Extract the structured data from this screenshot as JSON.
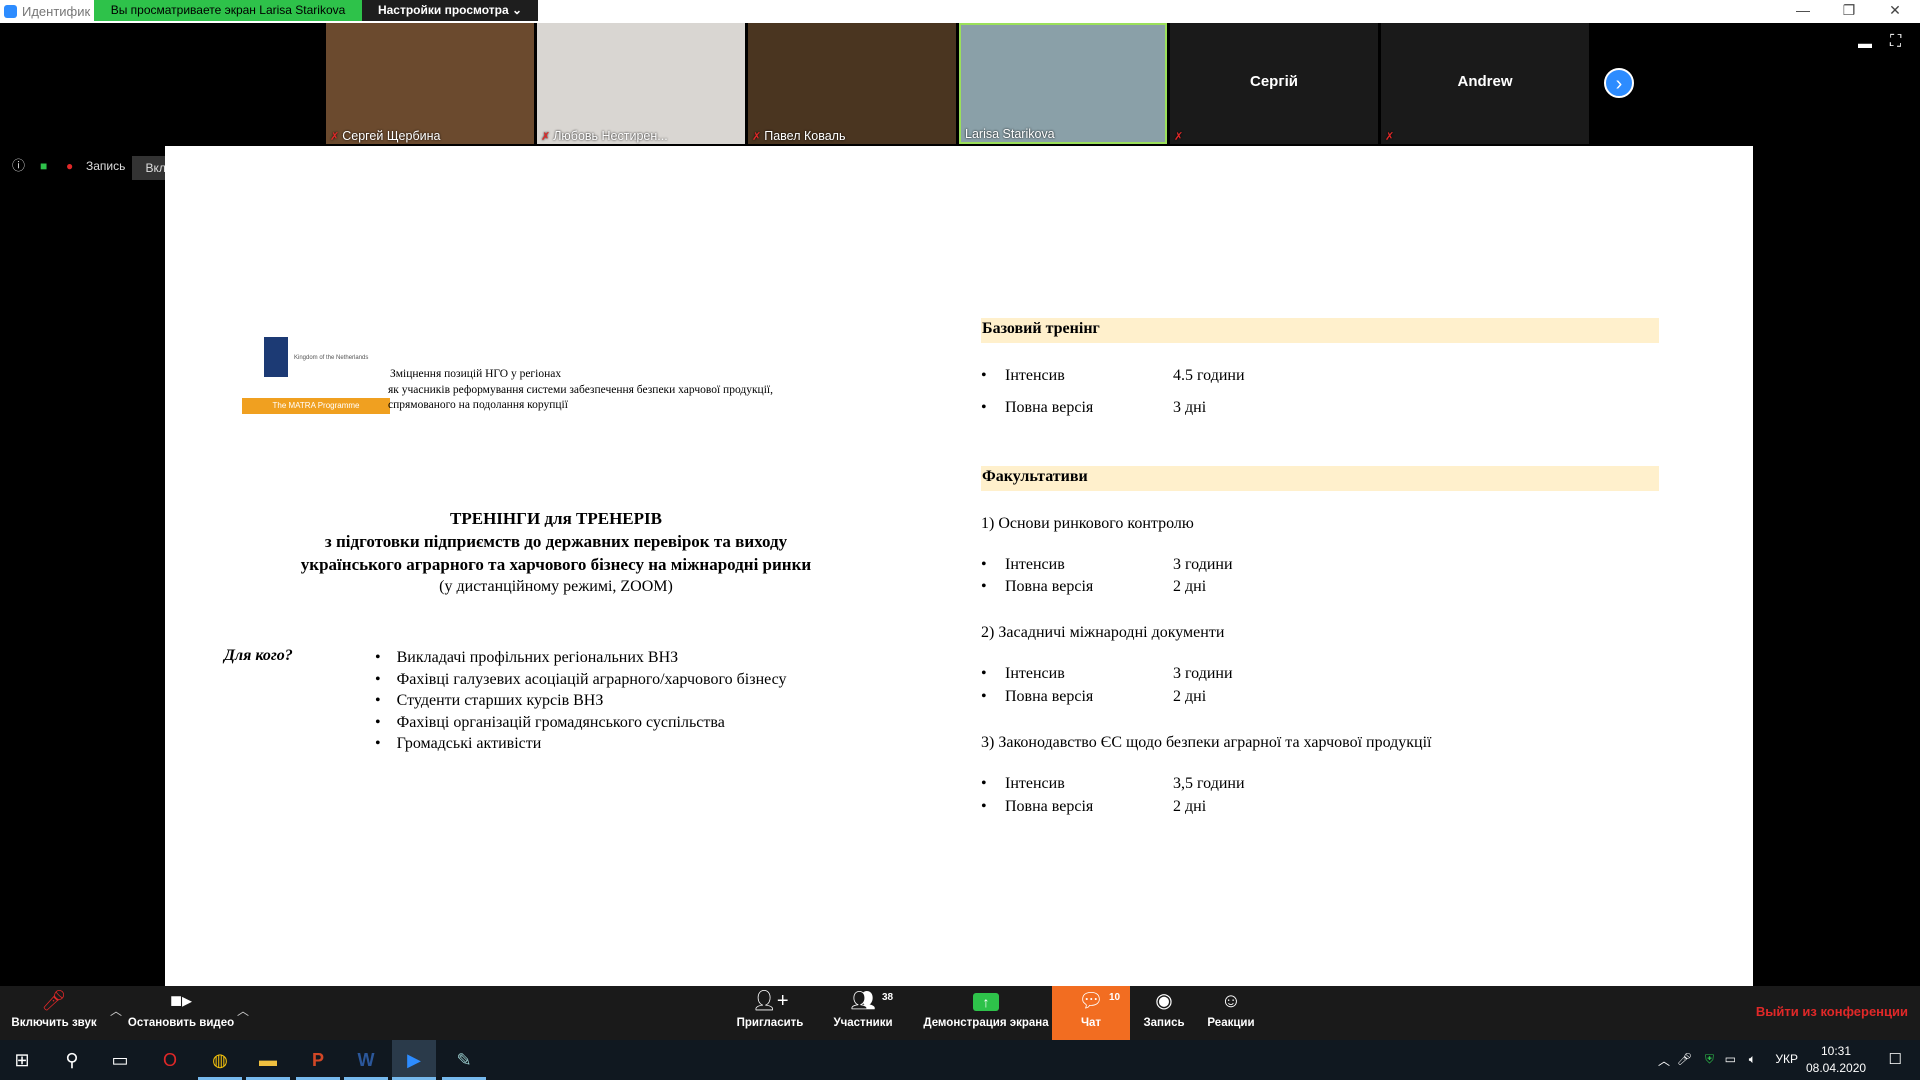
{
  "titlebar": {
    "app_title": "Идентифик",
    "share_banner": "Вы просматриваете экран Larisa Starikova",
    "view_options": "Настройки просмотра ⌄",
    "minimize": "—",
    "restore": "❐",
    "close": "✕"
  },
  "participants": [
    {
      "name": "Сергей Щербина",
      "muted": true,
      "video": true,
      "bg": "#6b4a2e"
    },
    {
      "name": "Любовь Нестирен...",
      "muted": true,
      "video": true,
      "bg": "#d9d6d2"
    },
    {
      "name": "Павел Коваль",
      "muted": true,
      "video": true,
      "bg": "#4a3520"
    },
    {
      "name": "Larisa Starikova",
      "muted": false,
      "video": true,
      "active": true,
      "bg": "#8aa0a8"
    },
    {
      "name": "Сергій",
      "muted": true,
      "video": false
    },
    {
      "name": "Andrew",
      "muted": true,
      "video": false
    }
  ],
  "infobar": {
    "record_label": "Запись",
    "original_sound": "Включить оригинальный звук"
  },
  "slide": {
    "ngo_line1": "Зміцнення позицій НГО у регіонах",
    "ngo_line2": "як учасників реформування системи забезпечення безпеки харчової продукції,",
    "ngo_line3": "спрямованого на подолання корупції",
    "logo_country": "Kingdom of the Netherlands",
    "logo_programme": "The MATRA Programme",
    "title1": "ТРЕНІНГИ для ТРЕНЕРІВ",
    "title2": "з підготовки підприємств до державних перевірок та виходу",
    "title3": "українського аграрного та харчового бізнесу на міжнародні ринки",
    "title4": "(у дистанційному режимі, ZOOM)",
    "for_whom": "Для кого?",
    "audience": [
      "Викладачі профільних регіональних ВНЗ",
      "Фахівці галузевих асоціацій аграрного/харчового бізнесу",
      "Студенти старших курсів ВНЗ",
      "Фахівці організацій громадянського суспільства",
      "Громадські активісти"
    ],
    "basic_title": "Базовий тренінг",
    "basic_intensive_label": "Інтенсив",
    "basic_intensive_value": "4.5 години",
    "basic_full_label": "Повна версія",
    "basic_full_value": "3 дні",
    "electives_title": "Факультативи",
    "electives": [
      {
        "title": "1)  Основи ринкового контролю",
        "intensive_label": "Інтенсив",
        "intensive_value": "3 години",
        "full_label": "Повна версія",
        "full_value": "2 дні"
      },
      {
        "title": "2)  Засадничі міжнародні документи",
        "intensive_label": "Інтенсив",
        "intensive_value": "3 години",
        "full_label": "Повна версія",
        "full_value": "2 дні"
      },
      {
        "title": "3)  Законодавство ЄС щодо безпеки аграрної та харчової продукції",
        "intensive_label": "Інтенсив",
        "intensive_value": "3,5 години",
        "full_label": "Повна версія",
        "full_value": "2 дні"
      }
    ],
    "bullet": "•"
  },
  "toolbar": {
    "unmute": "Включить звук",
    "stop_video": "Остановить видео",
    "invite": "Пригласить",
    "participants": "Участники",
    "participants_count": "38",
    "share_screen": "Демонстрация экрана",
    "chat": "Чат",
    "chat_count": "10",
    "record": "Запись",
    "reactions": "Реакции",
    "leave": "Выйти из конференции"
  },
  "taskbar": {
    "language": "УКР",
    "time": "10:31",
    "date": "08.04.2020"
  },
  "colors": {
    "zoom_blue": "#2d8cff",
    "share_green": "#2ec24a",
    "chat_orange": "#f26d21",
    "leave_red": "#e02828",
    "highlight": "#fff0cc"
  }
}
